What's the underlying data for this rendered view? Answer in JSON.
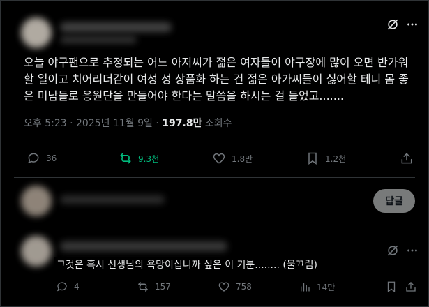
{
  "post": {
    "body": "오늘 야구팬으로 추정되는 어느 아저씨가 젊은 여자들이 야구장에 많이 오면 반가워할 일이고 치어리더같이 여성 성 상품화 하는 건 젊은 아가씨들이 싫어할 테니 몸 좋은 미남들로 응원단을 만들어야 한다는 말씀을 하시는 걸 들었고.......",
    "time": "오후 5:23",
    "date": "2025년 11월 9일",
    "views_count": "197.8만",
    "views_label": "조회수",
    "stats": {
      "replies": "36",
      "reposts": "9.3천",
      "likes": "1.8만",
      "bookmarks": "1.2천"
    }
  },
  "compose": {
    "reply_button": "답글"
  },
  "reply": {
    "text": "그것은 혹시 선생님의 욕망이십니까 싶은 이 기분........ (물끄럼)",
    "stats": {
      "replies": "4",
      "reposts": "157",
      "likes": "758",
      "views": "14만"
    }
  },
  "colors": {
    "repost_active": "#00ba7c",
    "muted": "#71767b",
    "text": "#e7e9ea"
  }
}
